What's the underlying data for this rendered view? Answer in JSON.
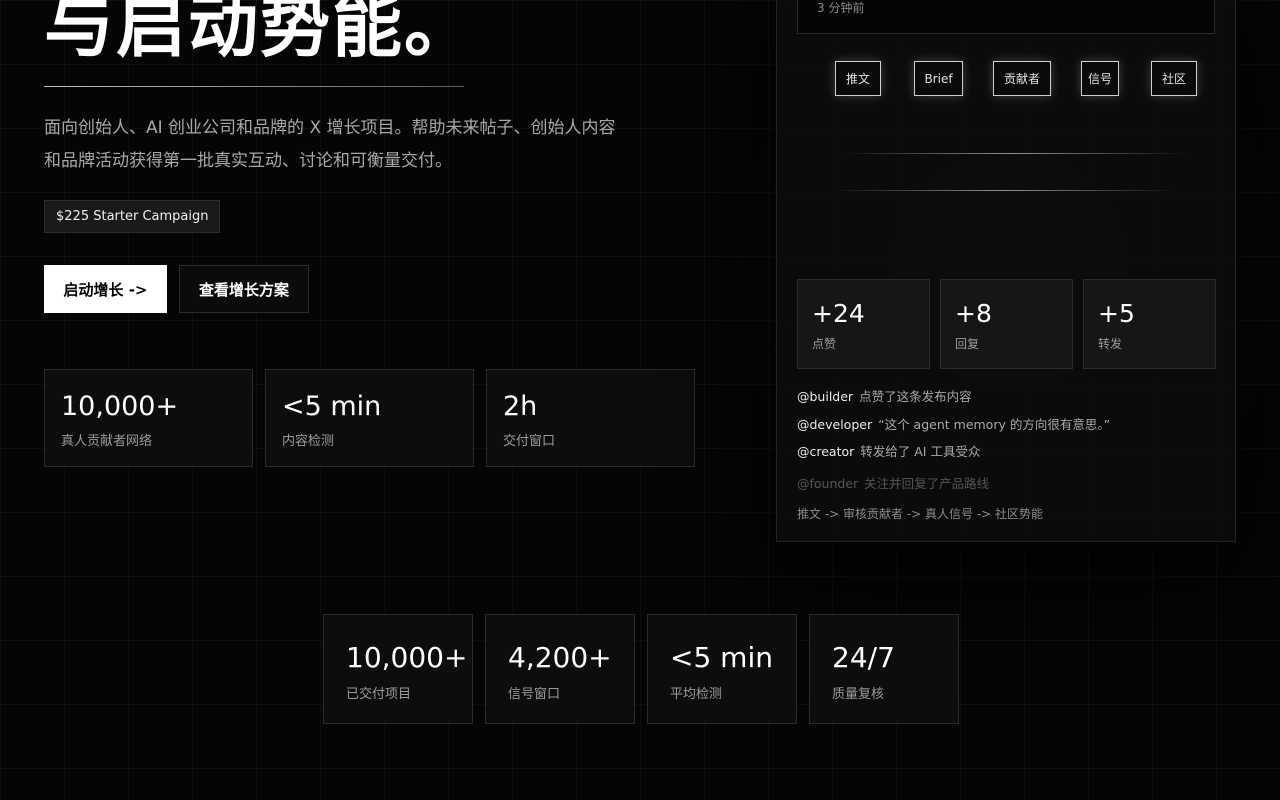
{
  "hero": {
    "headline": "与启动势能。",
    "subtitle_line1": "面向创始人、AI 创业公司和品牌的 X 增长项目。帮助未来帖子、创始人内容",
    "subtitle_line2": "和品牌活动获得第一批真实互动、讨论和可衡量交付。",
    "price_badge": "$225 Starter Campaign",
    "primary_cta": "启动增长 ->",
    "secondary_cta": "查看增长方案"
  },
  "stats": [
    {
      "value": "10,000+",
      "label": "真人贡献者网络"
    },
    {
      "value": "<5 min",
      "label": "内容检测"
    },
    {
      "value": "2h",
      "label": "交付窗口"
    }
  ],
  "panel": {
    "post_time": "3 分钟前",
    "chips": [
      "推文",
      "Brief",
      "贡献者",
      "信号",
      "社区"
    ],
    "metrics": [
      {
        "value": "+24",
        "label": "点赞"
      },
      {
        "value": "+8",
        "label": "回复"
      },
      {
        "value": "+5",
        "label": "转发"
      }
    ],
    "activity": [
      {
        "handle": "@builder",
        "text": "点赞了这条发布内容"
      },
      {
        "handle": "@developer",
        "text": "“这个 agent memory 的方向很有意思。”"
      },
      {
        "handle": "@creator",
        "text": "转发给了 AI 工具受众"
      },
      {
        "handle": "@founder",
        "text": "关注并回复了产品路线"
      }
    ],
    "pipeline": "推文 -> 审核贡献者 -> 真人信号 -> 社区势能"
  },
  "bottom_stats": [
    {
      "value": "10,000+",
      "label": "已交付项目"
    },
    {
      "value": "4,200+",
      "label": "信号窗口"
    },
    {
      "value": "<5 min",
      "label": "平均检测"
    },
    {
      "value": "24/7",
      "label": "质量复核"
    }
  ]
}
